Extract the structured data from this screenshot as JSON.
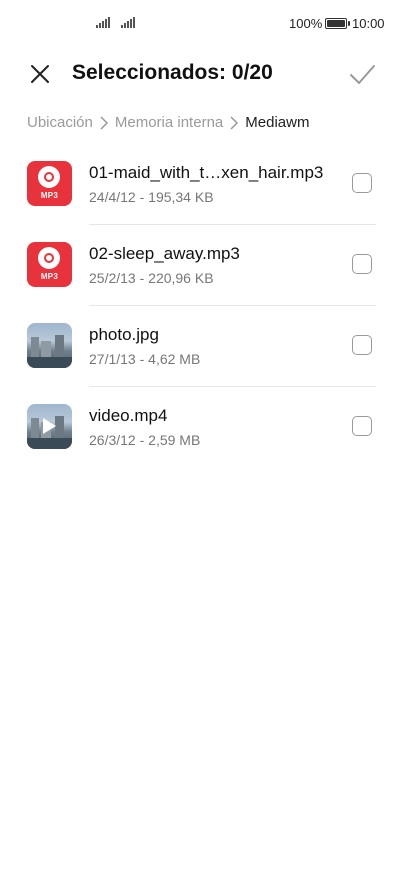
{
  "status_bar": {
    "battery_percent": "100%",
    "time": "10:00"
  },
  "header": {
    "title": "Seleccionados: 0/20",
    "close_icon": "close-icon",
    "confirm_icon": "check-icon"
  },
  "breadcrumb": {
    "items": [
      "Ubicación",
      "Memoria interna",
      "Mediawm"
    ]
  },
  "files": [
    {
      "name": "01-maid_with_t…xen_hair.mp3",
      "meta": "24/4/12 - 195,34 KB",
      "type": "mp3",
      "tag": "MP3",
      "checked": false
    },
    {
      "name": "02-sleep_away.mp3",
      "meta": "25/2/13 - 220,96 KB",
      "type": "mp3",
      "tag": "MP3",
      "checked": false
    },
    {
      "name": "photo.jpg",
      "meta": "27/1/13 - 4,62 MB",
      "type": "image",
      "checked": false
    },
    {
      "name": "video.mp4",
      "meta": "26/3/12 - 2,59 MB",
      "type": "video",
      "checked": false
    }
  ],
  "colors": {
    "accent_red": "#e8333c",
    "text_primary": "#111111",
    "text_secondary": "#777777"
  }
}
